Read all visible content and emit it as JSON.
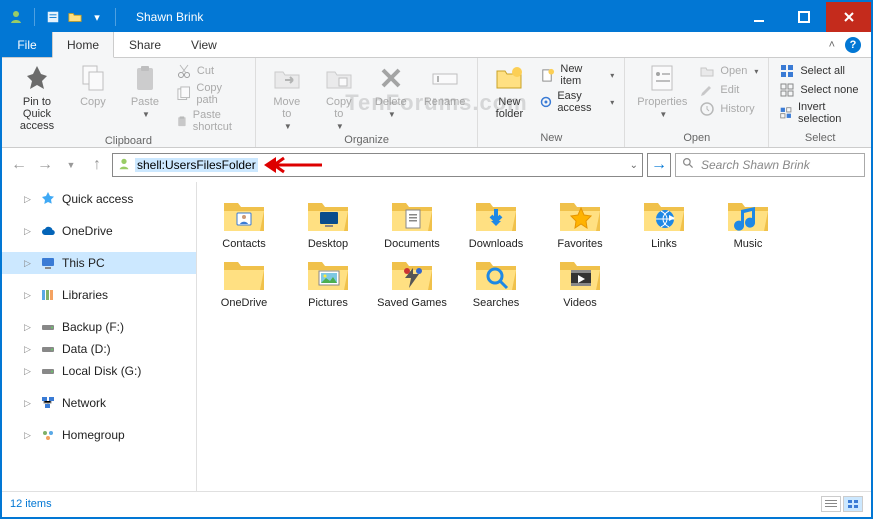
{
  "window": {
    "title": "Shawn Brink"
  },
  "tabs": {
    "file": "File",
    "home": "Home",
    "share": "Share",
    "view": "View"
  },
  "ribbon": {
    "clipboard": {
      "label": "Clipboard",
      "pin": "Pin to Quick\naccess",
      "copy": "Copy",
      "paste": "Paste",
      "cut": "Cut",
      "copypath": "Copy path",
      "pasteshortcut": "Paste shortcut"
    },
    "organize": {
      "label": "Organize",
      "moveto": "Move\nto",
      "copyto": "Copy\nto",
      "delete": "Delete",
      "rename": "Rename"
    },
    "new": {
      "label": "New",
      "newfolder": "New\nfolder",
      "newitem": "New item",
      "easyaccess": "Easy access"
    },
    "open": {
      "label": "Open",
      "properties": "Properties",
      "open": "Open",
      "edit": "Edit",
      "history": "History"
    },
    "select": {
      "label": "Select",
      "selectall": "Select all",
      "selectnone": "Select none",
      "invert": "Invert selection"
    }
  },
  "address": {
    "value": "shell:UsersFilesFolder",
    "search_placeholder": "Search Shawn Brink"
  },
  "sidebar": {
    "items": [
      {
        "label": "Quick access",
        "icon": "star"
      },
      {
        "label": "OneDrive",
        "icon": "cloud"
      },
      {
        "label": "This PC",
        "icon": "pc",
        "selected": true
      },
      {
        "label": "Libraries",
        "icon": "libraries"
      },
      {
        "label": "Backup (F:)",
        "icon": "drive"
      },
      {
        "label": "Data (D:)",
        "icon": "drive"
      },
      {
        "label": "Local Disk (G:)",
        "icon": "drive"
      },
      {
        "label": "Network",
        "icon": "network"
      },
      {
        "label": "Homegroup",
        "icon": "homegroup"
      }
    ]
  },
  "folders": [
    {
      "label": "Contacts",
      "icon": "contacts"
    },
    {
      "label": "Desktop",
      "icon": "desktop"
    },
    {
      "label": "Documents",
      "icon": "documents"
    },
    {
      "label": "Downloads",
      "icon": "downloads"
    },
    {
      "label": "Favorites",
      "icon": "favorites"
    },
    {
      "label": "Links",
      "icon": "links"
    },
    {
      "label": "Music",
      "icon": "music"
    },
    {
      "label": "OneDrive",
      "icon": "onedrive"
    },
    {
      "label": "Pictures",
      "icon": "pictures"
    },
    {
      "label": "Saved Games",
      "icon": "games"
    },
    {
      "label": "Searches",
      "icon": "searches"
    },
    {
      "label": "Videos",
      "icon": "videos"
    }
  ],
  "status": {
    "count": "12 items"
  },
  "watermark": "TenForums.com"
}
